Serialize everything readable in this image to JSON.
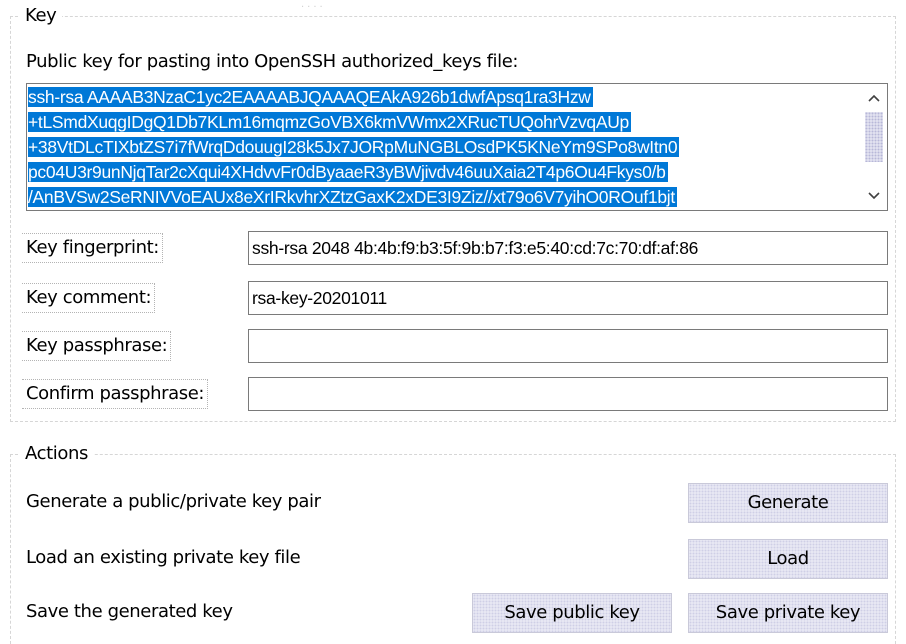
{
  "key_group": {
    "title": "Key",
    "public_key_label": "Public key for pasting into OpenSSH authorized_keys file:",
    "public_key_lines": [
      "ssh-rsa AAAAB3NzaC1yc2EAAAABJQAAAQEAkA926b1dwfApsq1ra3Hzw",
      "+tLSmdXuqgIDgQ1Db7KLm16mqmzGoVBX6kmVWmx2XRucTUQohrVzvqAUp",
      "+38VtDLcTIXbtZS7i7fWrqDdouugI28k5Jx7JORpMuNGBLOsdPK5KNeYm9SPo8wItn0",
      "pc04U3r9unNjqTar2cXqui4XHdvvFr0dByaaeR3yBWjivdv46uuXaia2T4p6Ou4Fkys0/b",
      "/AnBVSw2SeRNIVVoEAUx8eXrIRkvhrXZtzGaxK2xDE3I9Ziz//xt79o6V7yihO0ROuf1bjt"
    ],
    "scroll_up_icon": "chevron-up-icon",
    "scroll_down_icon": "chevron-down-icon",
    "fingerprint_label": "Key fingerprint:",
    "fingerprint_value": "ssh-rsa 2048 4b:4b:f9:b3:5f:9b:b7:f3:e5:40:cd:7c:70:df:af:86",
    "comment_label": "Key comment:",
    "comment_value": "rsa-key-20201011",
    "passphrase_label": "Key passphrase:",
    "passphrase_value": "",
    "confirm_label": "Confirm passphrase:",
    "confirm_value": ""
  },
  "actions_group": {
    "title": "Actions",
    "generate_text": "Generate a public/private key pair",
    "generate_button": "Generate",
    "load_text": "Load an existing private key file",
    "load_button": "Load",
    "save_text": "Save the generated key",
    "save_public_button": "Save public key",
    "save_private_button": "Save private key"
  },
  "colors": {
    "selection": "#0078d7",
    "button_face": "#ececf6",
    "border": "#7a7a7a"
  }
}
